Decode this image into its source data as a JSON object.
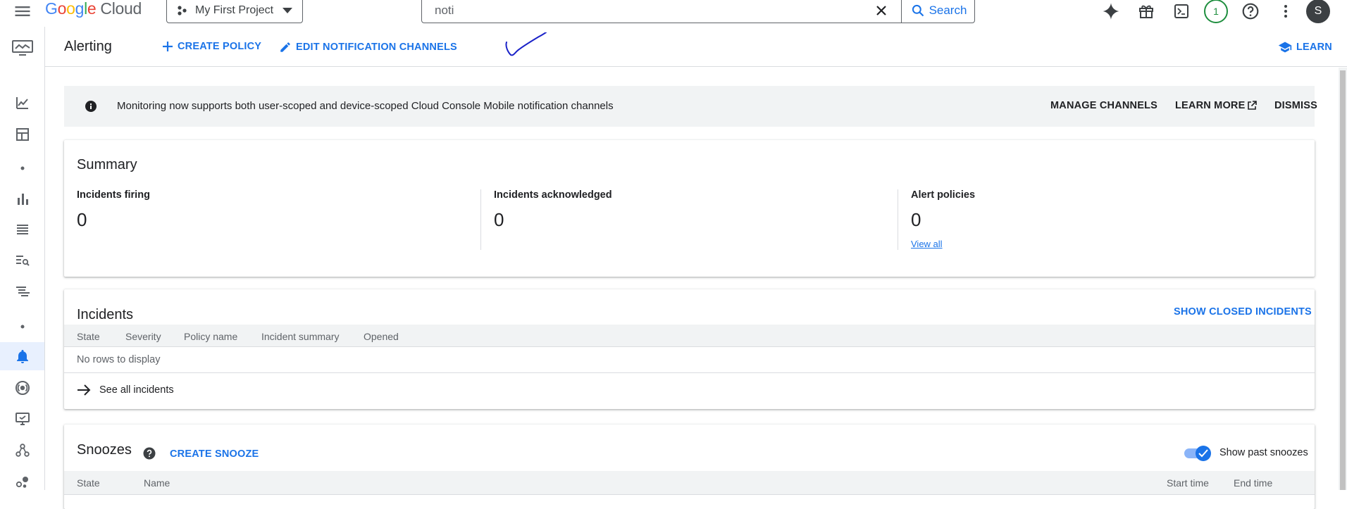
{
  "topbar": {
    "logo": {
      "g1": "G",
      "g2": "o",
      "g3": "o",
      "g4": "g",
      "g5": "l",
      "g6": "e",
      "product": "Cloud"
    },
    "project": "My First Project",
    "search": {
      "value": "noti",
      "button_label": "Search"
    },
    "notification_count": "1",
    "avatar_initial": "S"
  },
  "page": {
    "title": "Alerting",
    "create_policy": "CREATE POLICY",
    "edit_channels": "EDIT NOTIFICATION CHANNELS",
    "learn": "LEARN"
  },
  "banner": {
    "text": "Monitoring now supports both user-scoped and device-scoped Cloud Console Mobile notification channels",
    "manage": "MANAGE CHANNELS",
    "learn_more": "LEARN MORE",
    "dismiss": "DISMISS"
  },
  "summary": {
    "title": "Summary",
    "metrics": [
      {
        "label": "Incidents firing",
        "value": "0"
      },
      {
        "label": "Incidents acknowledged",
        "value": "0"
      },
      {
        "label": "Alert policies",
        "value": "0",
        "link": "View all"
      }
    ]
  },
  "incidents": {
    "title": "Incidents",
    "show_closed": "SHOW CLOSED INCIDENTS",
    "columns": [
      "State",
      "Severity",
      "Policy name",
      "Incident summary",
      "Opened"
    ],
    "empty": "No rows to display",
    "see_all": "See all incidents"
  },
  "snoozes": {
    "title": "Snoozes",
    "create": "CREATE SNOOZE",
    "toggle_label": "Show past snoozes",
    "toggle_on": true,
    "columns": [
      "State",
      "Name",
      "Start time",
      "End time"
    ]
  },
  "nav_icons": [
    "monitoring-overview-icon",
    "metrics-explorer-icon",
    "dashboards-icon",
    "dot-icon",
    "charts-icon",
    "logs-icon",
    "log-search-icon",
    "traces-icon",
    "dot-icon",
    "alerting-bell-icon",
    "uptime-checks-icon",
    "synthetic-monitoring-icon",
    "service-graph-icon",
    "groups-icon"
  ],
  "colors": {
    "accent": "#1a73e8",
    "active_nav": "#e8f0fe",
    "banner_bg": "#f1f3f4",
    "notif_ring": "#1e8e3e"
  }
}
